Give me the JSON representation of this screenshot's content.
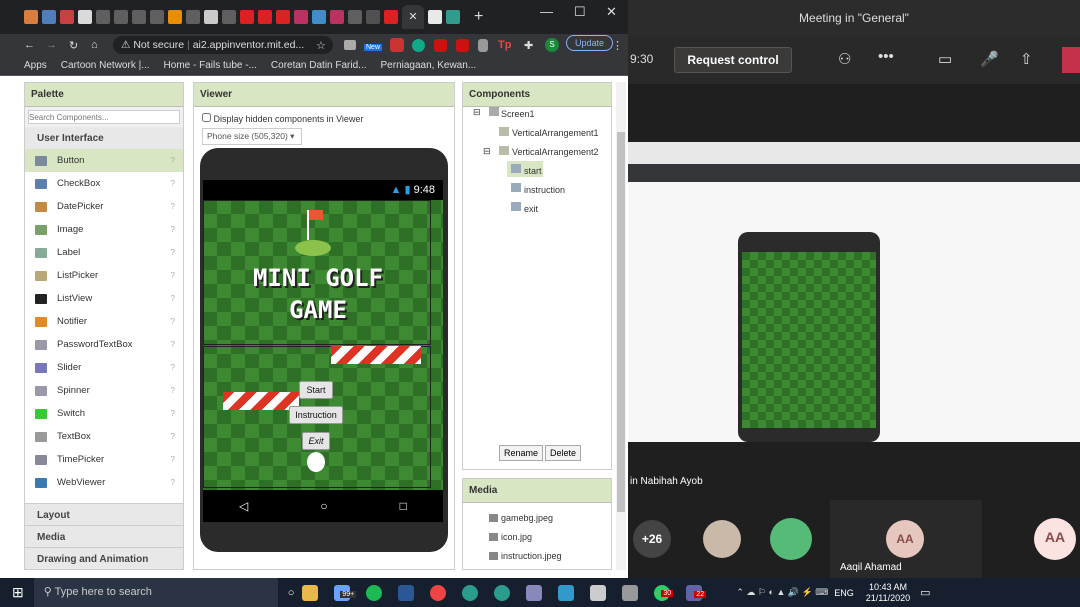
{
  "browser": {
    "url": "ai2.appinventor.mit.ed...",
    "security": "Not secure",
    "update_label": "Update",
    "profile_initial": "S",
    "new_badge": "New"
  },
  "bookmarks": [
    "Apps",
    "Cartoon Network |...",
    "Home - Fails tube -...",
    "Coretan Datin Farid...",
    "Perniagaan, Kewan..."
  ],
  "palette": {
    "title": "Palette",
    "search_placeholder": "Search Components...",
    "category": "User Interface",
    "items": [
      "Button",
      "CheckBox",
      "DatePicker",
      "Image",
      "Label",
      "ListPicker",
      "ListView",
      "Notifier",
      "PasswordTextBox",
      "Slider",
      "Spinner",
      "Switch",
      "TextBox",
      "TimePicker",
      "WebViewer"
    ],
    "categories": [
      "Layout",
      "Media",
      "Drawing and Animation"
    ]
  },
  "viewer": {
    "title": "Viewer",
    "checkbox_label": "Display hidden components in Viewer",
    "phone_size": "Phone size (505,320)",
    "time": "9:48",
    "game_title_line1": "MINI GOLF",
    "game_title_line2": "GAME",
    "buttons": [
      "Start",
      "Instruction",
      "Exit"
    ]
  },
  "components": {
    "title": "Components",
    "tree": [
      "Screen1",
      "VerticalArrangement1",
      "VerticalArrangement2",
      "start",
      "instruction",
      "exit"
    ],
    "rename": "Rename",
    "delete": "Delete"
  },
  "media": {
    "title": "Media",
    "files": [
      "gamebg.jpeg",
      "icon.jpg",
      "instruction.jpeg"
    ]
  },
  "teams": {
    "meeting_title": "Meeting in \"General\"",
    "time_fragment": "9:30",
    "request_control": "Request control",
    "presenter_name": "in Nabihah Ayob",
    "participant_count": "+26",
    "participant_name": "Aaqil Ahamad",
    "initials": "AA"
  },
  "taskbar": {
    "search": "Type here to search",
    "time": "10:43 AM",
    "date": "21/11/2020",
    "lang": "ENG",
    "mail_badge": "99+",
    "whatsapp_badge": "30",
    "teams_badge": "22"
  },
  "colors": {
    "panel_header": "#d9e6c3",
    "grass": "#3a7a2f",
    "teams_bg": "#1f1f1f",
    "taskbar": "#151f2e",
    "update_green": "#8ab4f8"
  }
}
